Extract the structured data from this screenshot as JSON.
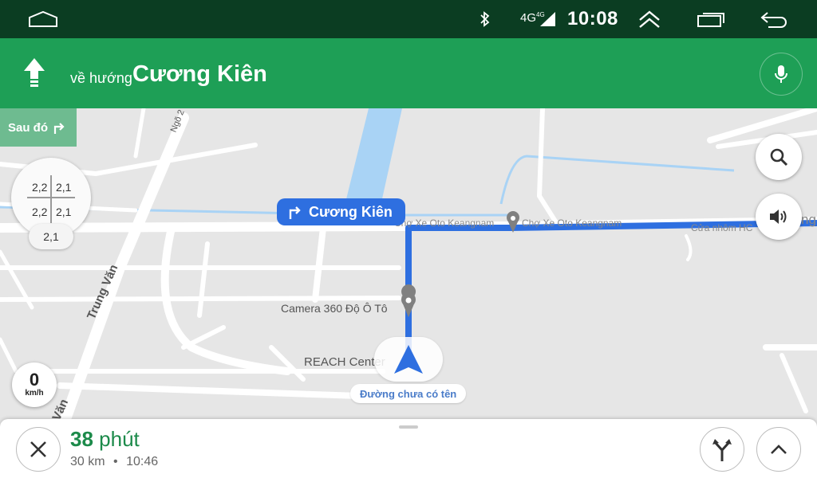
{
  "status_bar": {
    "time": "10:08",
    "network": "4G",
    "network_sup": "4G",
    "icons": [
      "home-icon",
      "bluetooth-icon",
      "signal-icon",
      "expand-icon",
      "recents-icon",
      "back-icon"
    ]
  },
  "navigation": {
    "toward_label": "về hướng",
    "street": "Cương Kiên",
    "then_label": "Sau đó",
    "turn_pill_street": "Cương Kiên",
    "accent_color": "#1e9f56"
  },
  "map": {
    "labels": {
      "ngo": "Ngõ 2",
      "trung_van": "Trung Văn",
      "van": "Văn",
      "camera": "Camera 360 Độ Ô Tô",
      "reach": "REACH Center",
      "keangnam1": "Chợ Xe Oto Keangnam",
      "keangnam2": "Chợ Xe Oto Keangnam",
      "cua_nhom": "Cửa nhôm HC",
      "ng": "ng",
      "unnamed_road": "Đường chưa có tên"
    },
    "lanes": {
      "top_left": "2,2",
      "top_right": "2,1",
      "bottom_left": "2,2",
      "bottom_right": "2,1",
      "below": "2,1"
    },
    "speed": {
      "value": "0",
      "unit": "km/h"
    }
  },
  "trip": {
    "minutes": "38",
    "minutes_unit": "phút",
    "distance": "30 km",
    "separator": "•",
    "arrival": "10:46"
  }
}
